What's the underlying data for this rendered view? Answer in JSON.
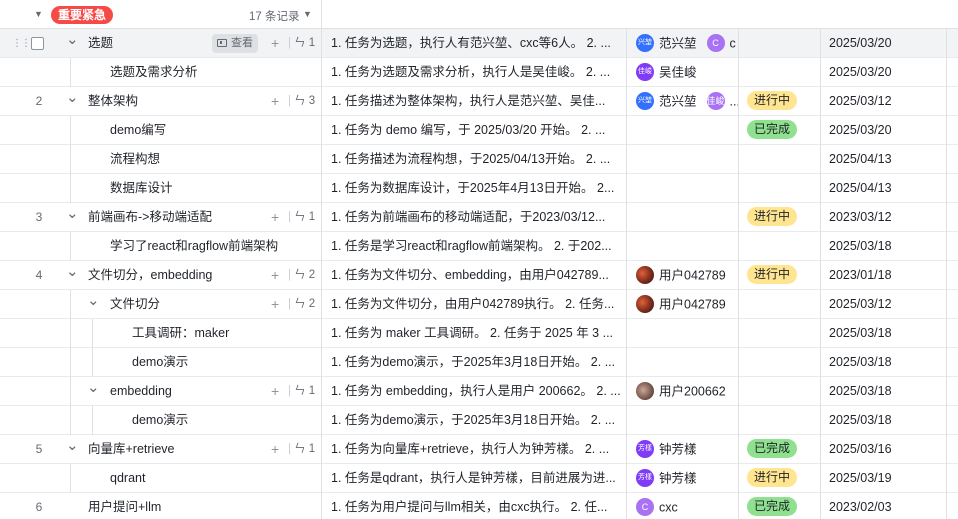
{
  "group": {
    "label": "重要紧急",
    "count": "17 条记录"
  },
  "view_button_label": "查看",
  "rows": [
    {
      "num": "",
      "level": 0,
      "chevron": true,
      "title": "选题",
      "subcount": "1",
      "selected": true,
      "view": true,
      "desc": "1. 任务为选题，执行人有范兴堃、cxc等6人。 2. ...",
      "owners": [
        {
          "avatar": "兴堃",
          "cls": "av-blue",
          "name": "范兴堃"
        },
        {
          "avatar": "C",
          "cls": "av-violet",
          "name": "c"
        }
      ],
      "status": "",
      "date": "2025/03/20"
    },
    {
      "num": "",
      "level": 1,
      "chevron": false,
      "title": "选题及需求分析",
      "desc": "1. 任务为选题及需求分析，执行人是吴佳峻。 2. ...",
      "owners": [
        {
          "avatar": "佳峻",
          "cls": "av-purple",
          "name": "吴佳峻"
        }
      ],
      "status": "",
      "date": "2025/03/20"
    },
    {
      "num": "2",
      "level": 0,
      "chevron": true,
      "title": "整体架构",
      "subcount": "3",
      "desc": "1. 任务描述为整体架构，执行人是范兴堃、吴佳...",
      "owners": [
        {
          "avatar": "兴堃",
          "cls": "av-blue",
          "name": "范兴堃"
        },
        {
          "avatar": "佳峻",
          "cls": "av-violet",
          "name": "..."
        }
      ],
      "status": "进行中",
      "status_type": "progress",
      "date": "2025/03/12"
    },
    {
      "num": "",
      "level": 1,
      "chevron": false,
      "title": "demo编写",
      "desc": "1. 任务为 demo 编写，于 2025/03/20 开始。 2. ...",
      "owners": [],
      "status": "已完成",
      "status_type": "done",
      "date": "2025/03/20"
    },
    {
      "num": "",
      "level": 1,
      "chevron": false,
      "title": "流程构想",
      "desc": "1. 任务描述为流程构想，于2025/04/13开始。 2. ...",
      "owners": [],
      "status": "",
      "date": "2025/04/13"
    },
    {
      "num": "",
      "level": 1,
      "chevron": false,
      "title": "数据库设计",
      "desc": "1. 任务为数据库设计，于2025年4月13日开始。 2...",
      "owners": [],
      "status": "",
      "date": "2025/04/13"
    },
    {
      "num": "3",
      "level": 0,
      "chevron": true,
      "title": "前端画布->移动端适配",
      "subcount": "1",
      "desc": "1. 任务为前端画布的移动端适配，于2023/03/12...",
      "owners": [],
      "status": "进行中",
      "status_type": "progress",
      "date": "2023/03/12"
    },
    {
      "num": "",
      "level": 1,
      "chevron": false,
      "title": "学习了react和ragflow前端架构",
      "desc": "1. 任务是学习react和ragflow前端架构。 2. 于202...",
      "owners": [],
      "status": "",
      "date": "2025/03/18"
    },
    {
      "num": "4",
      "level": 0,
      "chevron": true,
      "title": "文件切分，embedding",
      "subcount": "2",
      "desc": "1. 任务为文件切分、embedding，由用户042789...",
      "owners": [
        {
          "avatar": "",
          "cls": "av-photo1",
          "name": "用户042789"
        }
      ],
      "status": "进行中",
      "status_type": "progress",
      "date": "2023/01/18"
    },
    {
      "num": "",
      "level": 1,
      "chevron": true,
      "title": "文件切分",
      "subcount": "2",
      "desc": "1. 任务为文件切分，由用户042789执行。 2. 任务...",
      "owners": [
        {
          "avatar": "",
          "cls": "av-photo1",
          "name": "用户042789"
        }
      ],
      "status": "",
      "date": "2025/03/12"
    },
    {
      "num": "",
      "level": 2,
      "chevron": false,
      "title": "工具调研：maker",
      "desc": "1. 任务为 maker 工具调研。 2. 任务于 2025 年 3 ...",
      "owners": [],
      "status": "",
      "date": "2025/03/18"
    },
    {
      "num": "",
      "level": 2,
      "chevron": false,
      "title": "demo演示",
      "desc": "1. 任务为demo演示，于2025年3月18日开始。 2. ...",
      "owners": [],
      "status": "",
      "date": "2025/03/18"
    },
    {
      "num": "",
      "level": 1,
      "chevron": true,
      "title": "embedding",
      "subcount": "1",
      "desc": "1. 任务为 embedding，执行人是用户 200662。 2. ...",
      "owners": [
        {
          "avatar": "",
          "cls": "av-photo2",
          "name": "用户200662"
        }
      ],
      "status": "",
      "date": "2025/03/18"
    },
    {
      "num": "",
      "level": 2,
      "chevron": false,
      "title": "demo演示",
      "desc": "1. 任务为demo演示，于2025年3月18日开始。 2. ...",
      "owners": [],
      "status": "",
      "date": "2025/03/18"
    },
    {
      "num": "5",
      "level": 0,
      "chevron": true,
      "title": "向量库+retrieve",
      "subcount": "1",
      "desc": "1. 任务为向量库+retrieve，执行人为钟芳樣。 2. ...",
      "owners": [
        {
          "avatar": "芳樣",
          "cls": "av-purple",
          "name": "钟芳樣"
        }
      ],
      "status": "已完成",
      "status_type": "done",
      "date": "2025/03/16"
    },
    {
      "num": "",
      "level": 1,
      "chevron": false,
      "title": "qdrant",
      "desc": "1. 任务是qdrant，执行人是钟芳樣，目前进展为进...",
      "owners": [
        {
          "avatar": "芳樣",
          "cls": "av-purple",
          "name": "钟芳樣"
        }
      ],
      "status": "进行中",
      "status_type": "progress",
      "date": "2025/03/19"
    },
    {
      "num": "6",
      "level": 0,
      "chevron": false,
      "title": "用户提问+llm",
      "desc": "1. 任务为用户提问与llm相关，由cxc执行。 2. 任...",
      "owners": [
        {
          "avatar": "C",
          "cls": "av-violet",
          "name": "cxc"
        }
      ],
      "status": "已完成",
      "status_type": "done",
      "date": "2023/02/03"
    }
  ]
}
